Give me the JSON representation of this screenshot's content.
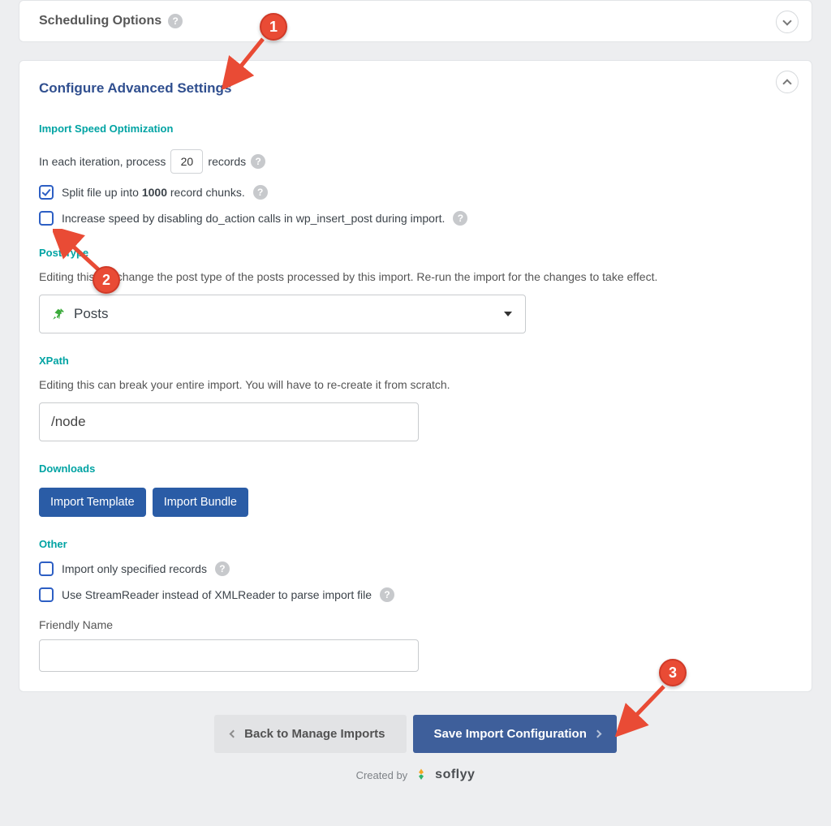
{
  "scheduling": {
    "title": "Scheduling Options"
  },
  "advanced": {
    "title": "Configure Advanced Settings",
    "sections": {
      "speed": {
        "label": "Import Speed Optimization",
        "iteration_prefix": "In each iteration, process",
        "iteration_value": "20",
        "iteration_suffix": "records",
        "split_prefix": "Split file up into ",
        "split_bold": "1000",
        "split_suffix": " record chunks.",
        "disable_action": "Increase speed by disabling do_action calls in wp_insert_post during import."
      },
      "post_type": {
        "label": "Post Type",
        "desc": "Editing this will change the post type of the posts processed by this import. Re-run the import for the changes to take effect.",
        "selected": "Posts"
      },
      "xpath": {
        "label": "XPath",
        "desc": "Editing this can break your entire import. You will have to re-create it from scratch.",
        "value": "/node"
      },
      "downloads": {
        "label": "Downloads",
        "import_template": "Import Template",
        "import_bundle": "Import Bundle"
      },
      "other": {
        "label": "Other",
        "only_specified": "Import only specified records",
        "stream_reader": "Use StreamReader instead of XMLReader to parse import file",
        "friendly_name_label": "Friendly Name"
      }
    }
  },
  "footer": {
    "back": "Back to Manage Imports",
    "save": "Save Import Configuration",
    "credit_prefix": "Created by",
    "brand": "soflyy"
  },
  "annotations": {
    "m1": "1",
    "m2": "2",
    "m3": "3"
  }
}
